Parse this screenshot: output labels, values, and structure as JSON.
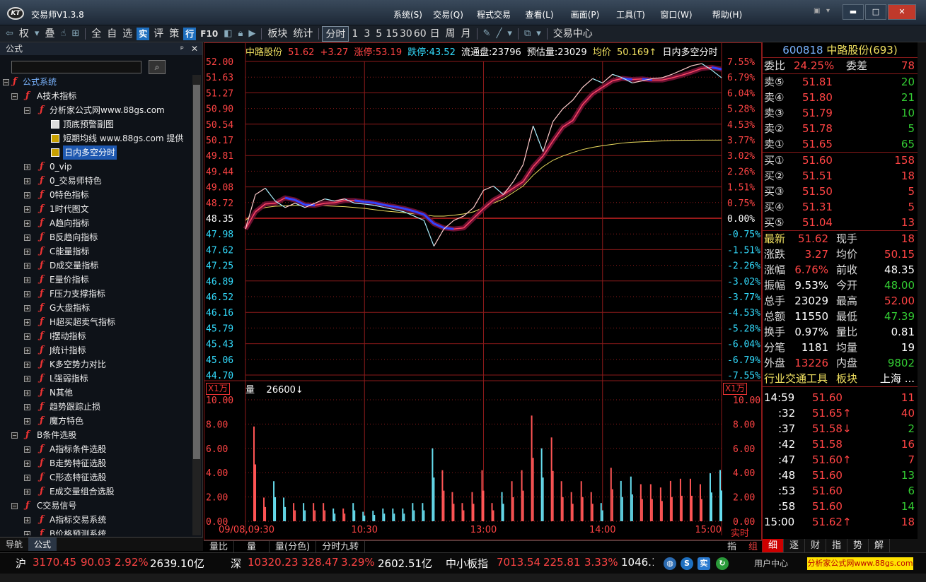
{
  "window": {
    "title": "交易师V1.3.8"
  },
  "menu": [
    "系统(S)",
    "交易(Q)",
    "程式交易",
    "查看(L)",
    "画面(P)",
    "工具(T)",
    "窗口(W)",
    "帮助(H)"
  ],
  "toolbar": {
    "items": [
      "权",
      "叠",
      "全",
      "自",
      "选",
      "实",
      "评",
      "策",
      "行",
      "F10",
      "板块",
      "统计",
      "分时",
      "1",
      "3",
      "5",
      "15",
      "30",
      "60",
      "日",
      "周",
      "月",
      "交易中心"
    ]
  },
  "left_panel": {
    "header": "公式",
    "search_placeholder": "",
    "tabs": [
      "导航",
      "公式"
    ],
    "tree": [
      {
        "label": "公式系统",
        "level": 0
      },
      {
        "label": "A技术指标",
        "level": 1
      },
      {
        "label": "分析家公式网www.88gs.com",
        "level": 2
      },
      {
        "label": "顶底预警副图",
        "level": 3
      },
      {
        "label": "短期均线 www.88gs.com 提供",
        "level": 3
      },
      {
        "label": "日内多空分时",
        "level": 3,
        "selected": true
      },
      {
        "label": "0_vip",
        "level": 2
      },
      {
        "label": "0_交易师特色",
        "level": 2
      },
      {
        "label": "0特色指标",
        "level": 2
      },
      {
        "label": "1时代图文",
        "level": 2
      },
      {
        "label": "A趋向指标",
        "level": 2
      },
      {
        "label": "B反趋向指标",
        "level": 2
      },
      {
        "label": "C能量指标",
        "level": 2
      },
      {
        "label": "D成交量指标",
        "level": 2
      },
      {
        "label": "E量价指标",
        "level": 2
      },
      {
        "label": "F压力支撑指标",
        "level": 2
      },
      {
        "label": "G大盘指标",
        "level": 2
      },
      {
        "label": "H超买超卖气指标",
        "level": 2
      },
      {
        "label": "I摆动指标",
        "level": 2
      },
      {
        "label": "J统计指标",
        "level": 2
      },
      {
        "label": "K多空势力对比",
        "level": 2
      },
      {
        "label": "L强弱指标",
        "level": 2
      },
      {
        "label": "N其他",
        "level": 2
      },
      {
        "label": "趋势跟踪止损",
        "level": 2
      },
      {
        "label": "魔方特色",
        "level": 2
      },
      {
        "label": "B条件选股",
        "level": 1
      },
      {
        "label": "A指标条件选股",
        "level": 2
      },
      {
        "label": "B走势特征选股",
        "level": 2
      },
      {
        "label": "C形态特征选股",
        "level": 2
      },
      {
        "label": "E成交量组合选股",
        "level": 2
      },
      {
        "label": "C交易信号",
        "level": 1
      },
      {
        "label": "A指标交易系统",
        "level": 2
      },
      {
        "label": "B价格预测系统",
        "level": 2
      }
    ]
  },
  "chart": {
    "legend": {
      "name": "中路股份",
      "price": "51.62",
      "change": "+3.27",
      "limit_up": "涨停:53.19",
      "limit_down": "跌停:43.52",
      "float": "流通盘:23796",
      "est_vol": "预估量:23029",
      "avg_label": "均价",
      "avg": "50.169↑",
      "indicator": "日内多空分时"
    },
    "vol_legend": {
      "label": "量",
      "value": "26600↓"
    },
    "x1_left": "X1万",
    "x1_right": "X1万",
    "realtime": "实时",
    "bottom_tabs": [
      "量比",
      "量",
      "量(分色)",
      "分时九转"
    ],
    "bottom_right": [
      "指",
      "组"
    ]
  },
  "chart_data": {
    "type": "line",
    "title": "中路股份",
    "price_axis": {
      "ticks": [
        "52.00",
        "51.63",
        "51.27",
        "50.90",
        "50.54",
        "50.17",
        "49.81",
        "49.44",
        "49.08",
        "48.72",
        "48.35",
        "47.98",
        "47.62",
        "47.25",
        "46.89",
        "46.52",
        "46.16",
        "45.79",
        "45.43",
        "45.06",
        "44.70"
      ],
      "ylim": [
        44.7,
        52.0
      ],
      "prev_close": 48.35
    },
    "pct_axis": {
      "ticks": [
        "7.55%",
        "6.79%",
        "6.04%",
        "5.28%",
        "4.53%",
        "3.77%",
        "3.02%",
        "2.26%",
        "1.51%",
        "0.75%",
        "0.00%",
        "-0.75%",
        "-1.51%",
        "-2.26%",
        "-3.02%",
        "-3.77%",
        "-4.53%",
        "-5.28%",
        "-6.04%",
        "-6.79%",
        "-7.55%"
      ]
    },
    "vol_axis": {
      "ticks": [
        "10.00",
        "8.00",
        "6.00",
        "4.00",
        "2.00",
        "0.00"
      ],
      "ylim": [
        0,
        10
      ]
    },
    "time_labels": [
      "09/08,09:30",
      "10:30",
      "13:00",
      "14:00",
      "15:00"
    ],
    "x": [
      0,
      5,
      10,
      15,
      20,
      25,
      30,
      35,
      40,
      45,
      50,
      55,
      60,
      65,
      70,
      75,
      80,
      85,
      90,
      95,
      100,
      105,
      110,
      115,
      120,
      125,
      130,
      135,
      140,
      145,
      150,
      155,
      160,
      165,
      170,
      175,
      180,
      185,
      190,
      195,
      200,
      205,
      210,
      215,
      220,
      225,
      230,
      235,
      240
    ],
    "series": [
      {
        "name": "价格",
        "color": "#ffffff",
        "values": [
          48.1,
          48.9,
          49.05,
          48.75,
          48.6,
          48.7,
          48.6,
          48.7,
          48.8,
          48.75,
          48.8,
          48.7,
          48.68,
          48.65,
          48.6,
          48.55,
          48.5,
          48.4,
          48.3,
          47.7,
          48.1,
          48.3,
          48.4,
          48.6,
          49.0,
          49.1,
          48.9,
          49.2,
          49.6,
          50.5,
          49.9,
          50.6,
          50.9,
          51.1,
          51.4,
          51.6,
          51.5,
          51.7,
          51.62,
          51.5,
          51.55,
          51.6,
          51.62,
          51.7,
          51.8,
          51.9,
          51.95,
          51.8,
          51.62
        ]
      },
      {
        "name": "均价",
        "color": "#f0e060",
        "values": [
          48.3,
          48.5,
          48.6,
          48.63,
          48.64,
          48.65,
          48.65,
          48.64,
          48.64,
          48.63,
          48.62,
          48.6,
          48.58,
          48.55,
          48.52,
          48.5,
          48.48,
          48.45,
          48.43,
          48.4,
          48.4,
          48.42,
          48.45,
          48.5,
          48.6,
          48.7,
          48.8,
          48.95,
          49.1,
          49.35,
          49.55,
          49.7,
          49.8,
          49.88,
          49.95,
          50.0,
          50.04,
          50.07,
          50.1,
          50.12,
          50.13,
          50.14,
          50.15,
          50.16,
          50.165,
          50.167,
          50.168,
          50.169,
          50.17
        ]
      }
    ]
  },
  "right_panel": {
    "code": "600818",
    "name": "中路股份(693)",
    "weibi_label": "委比",
    "weibi": "24.25%",
    "weicha_label": "委差",
    "weicha": "78",
    "asks": [
      {
        "label": "卖⑤",
        "price": "51.81",
        "vol": "20"
      },
      {
        "label": "卖④",
        "price": "51.80",
        "vol": "21"
      },
      {
        "label": "卖③",
        "price": "51.79",
        "vol": "10"
      },
      {
        "label": "卖②",
        "price": "51.78",
        "vol": "5"
      },
      {
        "label": "卖①",
        "price": "51.65",
        "vol": "65"
      }
    ],
    "bids": [
      {
        "label": "买①",
        "price": "51.60",
        "vol": "158"
      },
      {
        "label": "买②",
        "price": "51.51",
        "vol": "18"
      },
      {
        "label": "买③",
        "price": "51.50",
        "vol": "5"
      },
      {
        "label": "买④",
        "price": "51.31",
        "vol": "5"
      },
      {
        "label": "买⑤",
        "price": "51.04",
        "vol": "13"
      }
    ],
    "stats": [
      {
        "l1": "最新",
        "v1": "51.62",
        "l2": "现手",
        "v2": "18",
        "c1": "#ff4444",
        "c2": "#ff4444"
      },
      {
        "l1": "涨跌",
        "v1": "3.27",
        "l2": "均价",
        "v2": "50.15",
        "c1": "#ff4444",
        "c2": "#ff4444"
      },
      {
        "l1": "涨幅",
        "v1": "6.76%",
        "l2": "前收",
        "v2": "48.35",
        "c1": "#ff4444",
        "c2": "#ffffff"
      },
      {
        "l1": "振幅",
        "v1": "9.53%",
        "l2": "今开",
        "v2": "48.00",
        "c1": "#ffffff",
        "c2": "#33cc33"
      },
      {
        "l1": "总手",
        "v1": "23029",
        "l2": "最高",
        "v2": "52.00",
        "c1": "#ffffff",
        "c2": "#ff4444"
      },
      {
        "l1": "总额",
        "v1": "11550",
        "l2": "最低",
        "v2": "47.39",
        "c1": "#ffffff",
        "c2": "#33cc33"
      },
      {
        "l1": "换手",
        "v1": "0.97%",
        "l2": "量比",
        "v2": "0.81",
        "c1": "#ffffff",
        "c2": "#ffffff"
      },
      {
        "l1": "分笔",
        "v1": "1181",
        "l2": "均量",
        "v2": "19",
        "c1": "#ffffff",
        "c2": "#ffffff"
      },
      {
        "l1": "外盘",
        "v1": "13226",
        "l2": "内盘",
        "v2": "9802",
        "c1": "#ff4444",
        "c2": "#33cc33"
      }
    ],
    "industry": {
      "label": "行业",
      "name": "交通工具",
      "block": "板块",
      "region": "上海 ..."
    },
    "ticks": [
      {
        "t": "14:59",
        "p": "51.60",
        "v": "11",
        "vc": "#ff4444"
      },
      {
        "t": ":32",
        "p": "51.65↑",
        "v": "40",
        "vc": "#ff4444"
      },
      {
        "t": ":37",
        "p": "51.58↓",
        "v": "2",
        "vc": "#33cc33"
      },
      {
        "t": ":42",
        "p": "51.58",
        "v": "16",
        "vc": "#ff4444"
      },
      {
        "t": ":47",
        "p": "51.60↑",
        "v": "7",
        "vc": "#ff4444"
      },
      {
        "t": ":48",
        "p": "51.60",
        "v": "13",
        "vc": "#33cc33"
      },
      {
        "t": ":53",
        "p": "51.60",
        "v": "6",
        "vc": "#33cc33"
      },
      {
        "t": ":58",
        "p": "51.60",
        "v": "14",
        "vc": "#33cc33"
      },
      {
        "t": "15:00",
        "p": "51.62↑",
        "v": "18",
        "vc": "#ff4444"
      }
    ],
    "tabs": [
      "细",
      "逐",
      "财",
      "指",
      "势",
      "解"
    ]
  },
  "status": {
    "sh": {
      "label": "沪",
      "value": "3170.45",
      "change": "90.03",
      "pct": "2.92%",
      "amount": "2639.10亿"
    },
    "sz": {
      "label": "深",
      "value": "10320.23",
      "change": "328.47",
      "pct": "3.29%",
      "amount": "2602.51亿"
    },
    "zx": {
      "label": "中小板指",
      "value": "7013.54",
      "change": "225.81",
      "pct": "3.33%",
      "amount": "1046.1"
    },
    "user_center": "用户中心",
    "ad": "分析家公式网www.88gs.com"
  },
  "colors": {
    "up": "#ff4444",
    "down": "#33cc33",
    "grid": "#8b1a1a",
    "avg": "#f0e060"
  }
}
